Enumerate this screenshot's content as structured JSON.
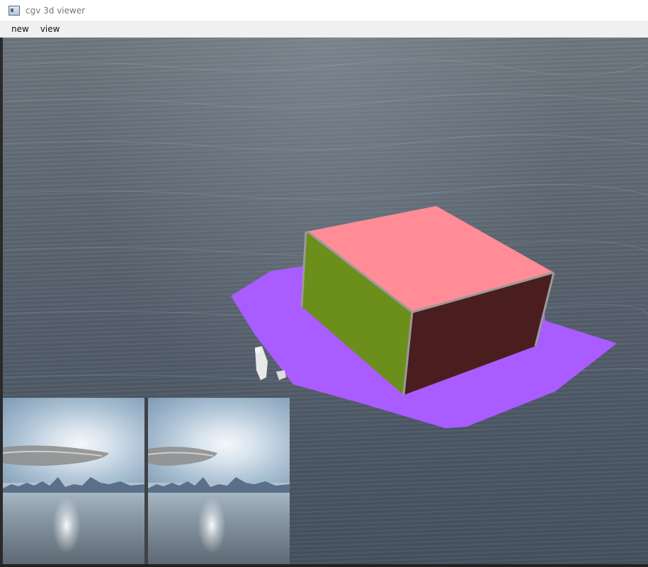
{
  "window": {
    "title": "cgv 3d viewer",
    "icon": "app-window-icon"
  },
  "menu": {
    "items": [
      {
        "label": "new"
      },
      {
        "label": "view"
      }
    ]
  },
  "scene": {
    "objects": [
      {
        "name": "box",
        "top_color": "#ff8c96",
        "left_color": "#6b8f1a",
        "right_color": "#4a1e1e"
      },
      {
        "name": "platform",
        "color": "#a95cff"
      },
      {
        "name": "controllers",
        "color": "#e8e8e8"
      }
    ],
    "background": "ocean",
    "eye_views": [
      {
        "name": "left-eye-view"
      },
      {
        "name": "right-eye-view"
      }
    ]
  }
}
